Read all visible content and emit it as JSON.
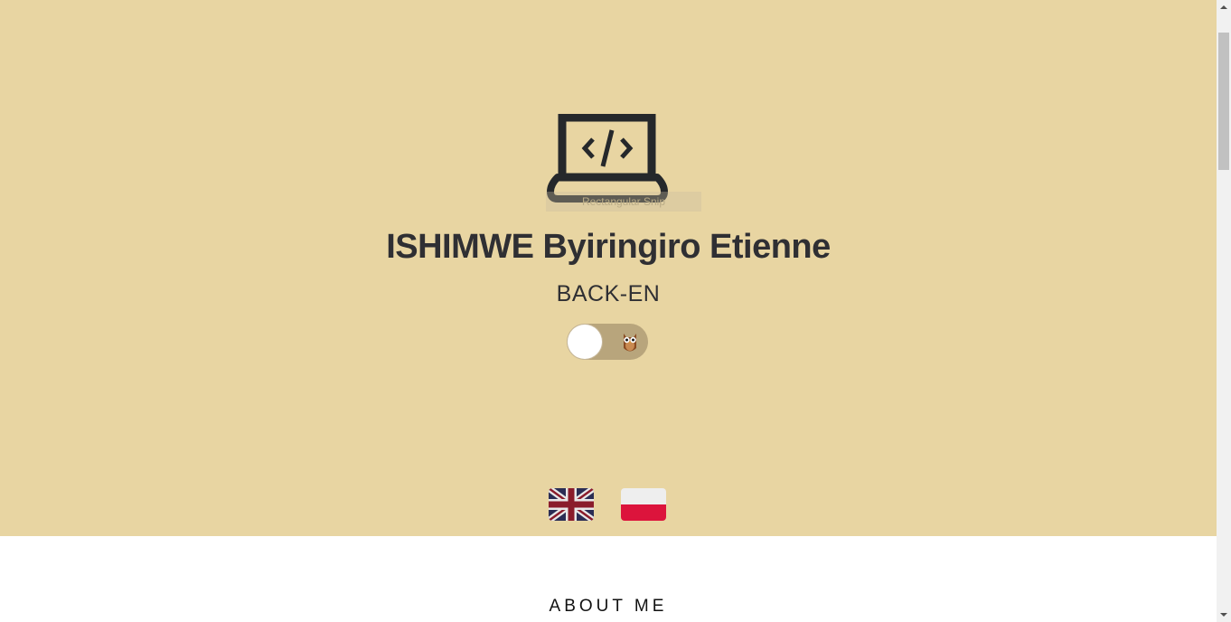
{
  "hero": {
    "background_color": "#e8d5a2",
    "logo_icon": "laptop-code-icon",
    "snip_tooltip": "Rectangular Snip",
    "name": "ISHIMWE Byiringiro Etienne",
    "role": "BACK-EN",
    "theme_toggle": {
      "state": "off",
      "icon": "owl-icon"
    }
  },
  "languages": [
    {
      "icon": "uk-flag-icon",
      "language": "English"
    },
    {
      "icon": "poland-flag-icon",
      "language": "Polish"
    }
  ],
  "about": {
    "heading": "ABOUT ME"
  },
  "colors": {
    "text": "#2f2f33",
    "toggle_track": "#b8a57c",
    "flag_red": "#dc143c"
  }
}
